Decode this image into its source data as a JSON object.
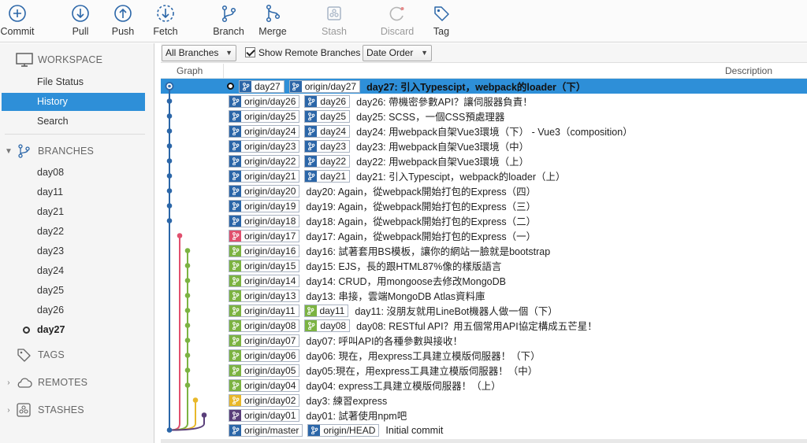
{
  "toolbar": {
    "buttons": [
      {
        "id": "commit",
        "label": "Commit",
        "icon": "plus-circle-icon",
        "enabled": true
      },
      {
        "id": "pull",
        "label": "Pull",
        "icon": "arrow-down-circle-icon",
        "enabled": true
      },
      {
        "id": "push",
        "label": "Push",
        "icon": "arrow-up-circle-icon",
        "enabled": true
      },
      {
        "id": "fetch",
        "label": "Fetch",
        "icon": "fetch-dashed-circle-icon",
        "enabled": true
      },
      {
        "id": "branch",
        "label": "Branch",
        "icon": "branch-icon",
        "enabled": true
      },
      {
        "id": "merge",
        "label": "Merge",
        "icon": "merge-icon",
        "enabled": true
      },
      {
        "id": "stash",
        "label": "Stash",
        "icon": "stash-icon",
        "enabled": false
      },
      {
        "id": "discard",
        "label": "Discard",
        "icon": "discard-icon",
        "enabled": false
      },
      {
        "id": "tag",
        "label": "Tag",
        "icon": "tag-icon",
        "enabled": true
      }
    ]
  },
  "sidebar": {
    "workspace": {
      "label": "WORKSPACE",
      "items": [
        "File Status",
        "History",
        "Search"
      ],
      "selected": "History"
    },
    "branches": {
      "label": "BRANCHES",
      "items": [
        "day08",
        "day11",
        "day21",
        "day22",
        "day23",
        "day24",
        "day25",
        "day26",
        "day27"
      ],
      "current": "day27"
    },
    "tags": {
      "label": "TAGS"
    },
    "remotes": {
      "label": "REMOTES"
    },
    "stashes": {
      "label": "STASHES"
    }
  },
  "filterbar": {
    "branches_dropdown": "All Branches",
    "show_remote_label": "Show Remote Branches",
    "show_remote_checked": true,
    "order_dropdown": "Date Order"
  },
  "columns": {
    "graph": "Graph",
    "description": "Description"
  },
  "colors": {
    "selection": "#2e8fd8",
    "lane_main": "#2b66a8",
    "lane_pink": "#e0506e",
    "lane_green": "#7cb342",
    "lane_yellow": "#e8b82a",
    "lane_purple": "#5a3f7a"
  },
  "commits": [
    {
      "refs_first": [
        "day27",
        "origin/day27"
      ],
      "current": true,
      "selected": true,
      "message": "day27: 引入Typescipt，webpack的loader（下）",
      "color": "#2b66a8"
    },
    {
      "refs_first": [
        "origin/day26",
        "day26"
      ],
      "message": "day26: 帶機密參數API？讓伺服器負責！",
      "color": "#2b66a8"
    },
    {
      "refs_first": [
        "origin/day25",
        "day25"
      ],
      "message": "day25: SCSS，一個CSS預處理器",
      "color": "#2b66a8"
    },
    {
      "refs_first": [
        "origin/day24",
        "day24"
      ],
      "message": "day24: 用webpack自架Vue3環境（下） - Vue3（composition）",
      "color": "#2b66a8"
    },
    {
      "refs_first": [
        "origin/day23",
        "day23"
      ],
      "message": "day23: 用webpack自架Vue3環境（中）",
      "color": "#2b66a8"
    },
    {
      "refs_first": [
        "origin/day22",
        "day22"
      ],
      "message": "day22: 用webpack自架Vue3環境（上）",
      "color": "#2b66a8"
    },
    {
      "refs_first": [
        "origin/day21",
        "day21"
      ],
      "message": "day21: 引入Typescipt，webpack的loader（上）",
      "color": "#2b66a8"
    },
    {
      "refs_first": [
        "origin/day20"
      ],
      "message": "day20: Again，從webpack開始打包的Express（四）",
      "color": "#2b66a8"
    },
    {
      "refs_first": [
        "origin/day19"
      ],
      "message": "day19: Again，從webpack開始打包的Express（三）",
      "color": "#2b66a8"
    },
    {
      "refs_first": [
        "origin/day18"
      ],
      "message": "day18: Again，從webpack開始打包的Express（二）",
      "color": "#2b66a8"
    },
    {
      "refs_first": [
        "origin/day17"
      ],
      "message": "day17: Again，從webpack開始打包的Express（一）",
      "color": "#e0506e"
    },
    {
      "refs_first": [
        "origin/day16"
      ],
      "message": "day16: 試著套用BS模板，讓你的網站一臉就是bootstrap",
      "color": "#7cb342"
    },
    {
      "refs_first": [
        "origin/day15"
      ],
      "message": "day15: EJS，長的跟HTML87%像的樣版語言",
      "color": "#7cb342"
    },
    {
      "refs_first": [
        "origin/day14"
      ],
      "message": "day14: CRUD，用mongoose去修改MongoDB",
      "color": "#7cb342"
    },
    {
      "refs_first": [
        "origin/day13"
      ],
      "message": "day13: 串接，雲端MongoDB Atlas資料庫",
      "color": "#7cb342"
    },
    {
      "refs_first": [
        "origin/day11",
        "day11"
      ],
      "message": "day11: 沒朋友就用LineBot機器人做一個（下）",
      "color": "#7cb342"
    },
    {
      "refs_first": [
        "origin/day08",
        "day08"
      ],
      "message": "day08: RESTful API？用五個常用API協定構成五芒星！",
      "color": "#7cb342"
    },
    {
      "refs_first": [
        "origin/day07"
      ],
      "message": "day07: 呼叫API的各種參數與接收！",
      "color": "#7cb342"
    },
    {
      "refs_first": [
        "origin/day06"
      ],
      "message": "day06: 現在，用express工具建立模版伺服器！（下）",
      "color": "#7cb342"
    },
    {
      "refs_first": [
        "origin/day05"
      ],
      "message": "day05:現在，用express工具建立模版伺服器！（中）",
      "color": "#7cb342"
    },
    {
      "refs_first": [
        "origin/day04"
      ],
      "message": "day04: express工具建立模版伺服器！（上）",
      "color": "#7cb342"
    },
    {
      "refs_first": [
        "origin/day02"
      ],
      "message": "day3: 練習express",
      "color": "#e8b82a"
    },
    {
      "refs_first": [
        "origin/day01"
      ],
      "message": "day01: 試著使用npm吧",
      "color": "#5a3f7a"
    },
    {
      "refs_first": [
        "origin/master",
        "origin/HEAD"
      ],
      "message": "Initial commit",
      "color": "#2b66a8"
    }
  ]
}
